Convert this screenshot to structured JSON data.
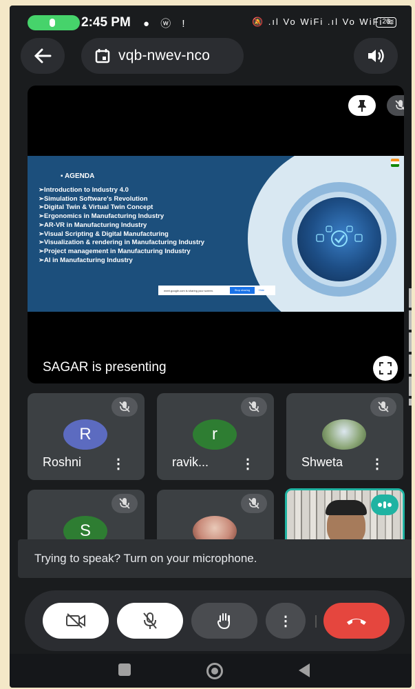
{
  "status_bar": {
    "time": "2:45 PM",
    "left_icons": "● ⓦ !",
    "right_icons": "🔕 .ıl Vo WiFi .ıl Vo WiFi ≋",
    "battery": "26"
  },
  "header": {
    "meeting_code": "vqb-nwev-nco"
  },
  "presentation": {
    "presenter_label": "SAGAR is presenting",
    "slide": {
      "title": "AGENDA",
      "items": [
        "➢Introduction to Industry 4.0",
        "➢Simulation Software's Revolution",
        "➢Digital Twin & Virtual Twin Concept",
        "➢Ergonomics in Manufacturing Industry",
        "➢AR-VR in Manufacturing Industry",
        "➢Visual Scripting & Digital Manufacturing",
        "➢Visualization & rendering in Manufacturing Industry",
        "➢Project management in Manufacturing Industry",
        "➢AI in Manufacturing Industry"
      ],
      "share_bar_text": "meet.google.com is sharing your screen.",
      "share_stop": "Stop sharing",
      "share_hide": "Hide"
    }
  },
  "participants": [
    {
      "name": "Roshni",
      "initial": "R",
      "color": "#5c6bc0"
    },
    {
      "name": "ravik...",
      "initial": "r",
      "color": "#2e7d32"
    },
    {
      "name": "Shweta",
      "initial": "",
      "color": "#6e8f5a"
    },
    {
      "name": "",
      "initial": "S",
      "color": "#2e7d32"
    },
    {
      "name": "",
      "initial": "",
      "color": "#c98b7a"
    }
  ],
  "toast": {
    "message": "Trying to speak? Turn on your microphone."
  },
  "controls": {
    "more_label": "⋮"
  },
  "colors": {
    "accent_green": "#46d36b",
    "end_call_red": "#e5463e",
    "speaking_teal": "#1fb3a2"
  }
}
